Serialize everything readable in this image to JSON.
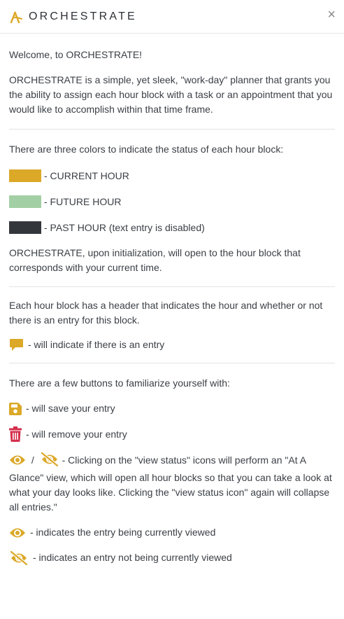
{
  "header": {
    "title": "ORCHESTRATE",
    "close_label": "×"
  },
  "intro": {
    "welcome": "Welcome, to ORCHESTRATE!",
    "description": "ORCHESTRATE is a simple, yet sleek, \"work-day\" planner that grants you the ability to assign each hour block with a task or an appointment that you would like to accomplish within that time frame."
  },
  "colors_section": {
    "intro": "There are three colors to indicate the status of each hour block:",
    "legend": [
      {
        "label": "- CURRENT HOUR",
        "color": "#dba828"
      },
      {
        "label": "- FUTURE HOUR",
        "color": "#a3cfa4"
      },
      {
        "label": "- PAST HOUR (text entry is disabled)",
        "color": "#33373c"
      }
    ],
    "outro": "ORCHESTRATE, upon initialization, will open to the hour block that corresponds with your current time."
  },
  "header_section": {
    "intro": "Each hour block has a header that indicates the hour and whether or not there is an entry for this block.",
    "entry_icon": "comment-icon",
    "entry_text": "- will indicate if there is an entry"
  },
  "buttons_section": {
    "intro": "There are a few buttons to familiarize yourself with:",
    "save_icon": "save-icon",
    "save_text": "- will save your entry",
    "remove_icon": "trash-icon",
    "remove_text": "- will remove your entry",
    "view_status_separator": "/",
    "view_status_text": "- Clicking on the \"view status\" icons will perform an \"At A Glance\" view, which will open all hour blocks so that you can take a look at what your day looks like. Clicking the \"view status icon\" again will collapse all entries.\"",
    "viewed_icon": "eye-icon",
    "viewed_text": "- indicates the entry being currently viewed",
    "not_viewed_icon": "eye-slash-icon",
    "not_viewed_text": "- indicates an entry not being currently viewed"
  },
  "colors": {
    "accent": "#dba828",
    "danger": "#d42f4c",
    "future": "#a3cfa4",
    "past": "#33373c"
  }
}
